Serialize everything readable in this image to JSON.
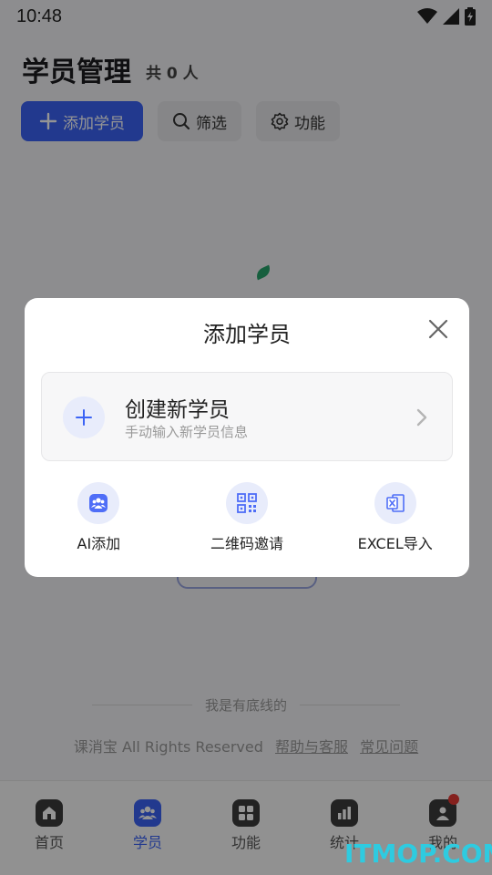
{
  "status_bar": {
    "time": "10:48"
  },
  "header": {
    "title": "学员管理",
    "count": "共 0 人"
  },
  "toolbar": {
    "add_label": "添加学员",
    "filter_label": "筛选",
    "function_label": "功能"
  },
  "footer": {
    "slogan": "我是有底线的",
    "copyright": "课消宝 All Rights Reserved",
    "help_link": "帮助与客服",
    "faq_link": "常见问题"
  },
  "tabs": [
    {
      "label": "首页",
      "icon": "home-icon"
    },
    {
      "label": "学员",
      "icon": "students-icon",
      "active": true
    },
    {
      "label": "功能",
      "icon": "grid-icon"
    },
    {
      "label": "统计",
      "icon": "stats-icon"
    },
    {
      "label": "我的",
      "icon": "profile-icon",
      "badge": true
    }
  ],
  "dialog": {
    "title": "添加学员",
    "create": {
      "title": "创建新学员",
      "subtitle": "手动输入新学员信息"
    },
    "actions": [
      {
        "label": "AI添加",
        "icon": "ai-people-icon"
      },
      {
        "label": "二维码邀请",
        "icon": "qrcode-icon"
      },
      {
        "label": "EXCEL导入",
        "icon": "excel-icon"
      }
    ]
  },
  "watermark": "ITMOP.COM",
  "colors": {
    "primary": "#3b63f5",
    "light_primary": "#e8ecfb",
    "badge": "#e53935"
  }
}
